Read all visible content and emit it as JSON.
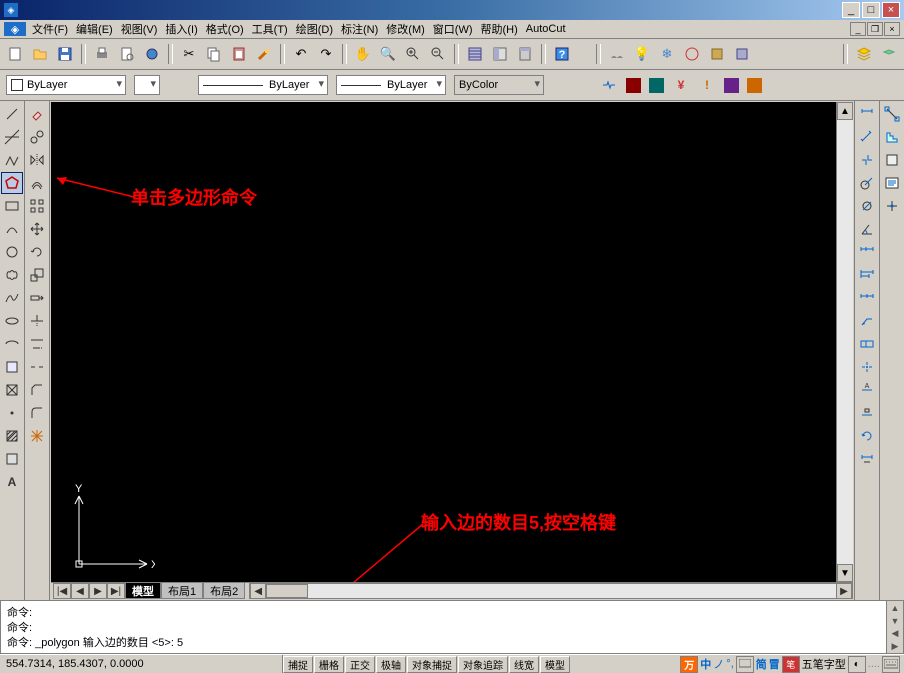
{
  "title_app_icon": "◈",
  "menus": [
    "文件(F)",
    "编辑(E)",
    "视图(V)",
    "插入(I)",
    "格式(O)",
    "工具(T)",
    "绘图(D)",
    "标注(N)",
    "修改(M)",
    "窗口(W)",
    "帮助(H)",
    "AutoCut"
  ],
  "layer": {
    "label": "ByLayer",
    "linetype": "ByLayer",
    "lineweight": "ByLayer",
    "color": "ByColor"
  },
  "tabs": {
    "navFirst": "|◀",
    "navPrev": "◀",
    "navNext": "▶",
    "navLast": "▶|",
    "model": "模型",
    "layout1": "布局1",
    "layout2": "布局2"
  },
  "ucs": {
    "x": "X",
    "y": "Y"
  },
  "annotations": {
    "annot1": "单击多边形命令",
    "annot2": "输入边的数目5,按空格键"
  },
  "cmd": {
    "line1": "命令:",
    "line2": "命令:",
    "line3": "命令: _polygon 输入边的数目 <5>: 5"
  },
  "status": {
    "coords": "554.7314, 185.4307, 0.0000",
    "modes": [
      "捕捉",
      "栅格",
      "正交",
      "极轴",
      "对象捕捉",
      "对象追踪",
      "线宽",
      "模型"
    ]
  },
  "ime": {
    "icon1": "万",
    "label1": "中",
    "icon2": "ノ",
    "icon3": "°,",
    "icon4": "简",
    "icon5": "冒",
    "label2": "五笔字型"
  },
  "winbtns": {
    "min": "_",
    "max": "□",
    "close": "×",
    "min2": "_",
    "restore": "❐",
    "close2": "×"
  },
  "icons": {
    "new": "□",
    "open": "📂",
    "save": "💾"
  }
}
